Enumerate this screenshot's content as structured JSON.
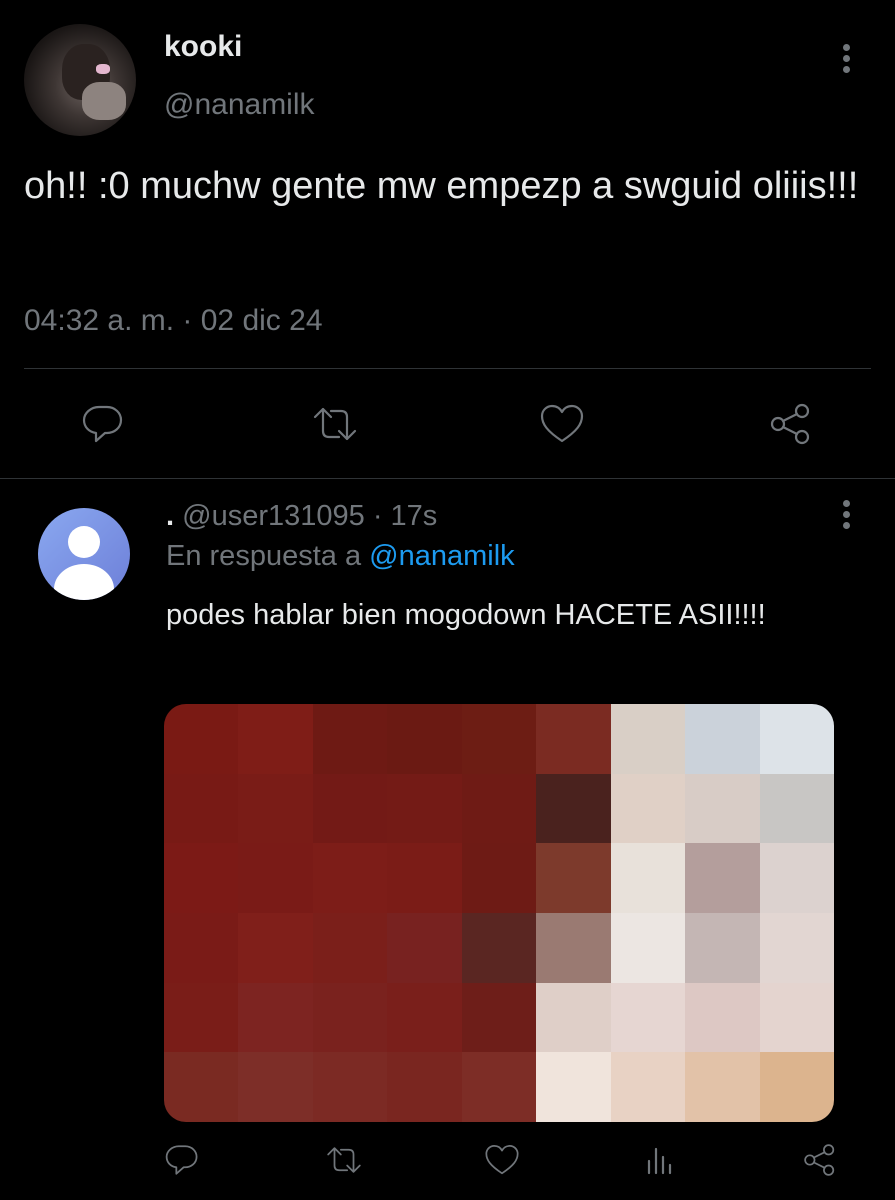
{
  "main_tweet": {
    "display_name": "kooki",
    "handle": "@nanamilk",
    "text": "oh!! :0 muchw gente mw empezp a swguid oliiis!!!",
    "timestamp": "04:32 a. m. · 02 dic 24",
    "actions": [
      "reply-icon",
      "retweet-icon",
      "like-icon",
      "share-icon"
    ]
  },
  "reply": {
    "display_name": ".",
    "handle": "@user131095",
    "time_sep": "·",
    "time": "17s",
    "in_reply_prefix": "En respuesta a",
    "in_reply_mention": "@nanamilk",
    "text": "podes hablar bien mogodown HACETE ASII!!!!",
    "media_alt": "pixelated image",
    "actions": [
      "reply-icon",
      "retweet-icon",
      "like-icon",
      "views-icon",
      "share-icon"
    ]
  },
  "colors": {
    "background": "#000000",
    "text": "#e7e9ea",
    "muted": "#71767b",
    "link": "#1d9bf0",
    "divider": "#2f3336"
  }
}
